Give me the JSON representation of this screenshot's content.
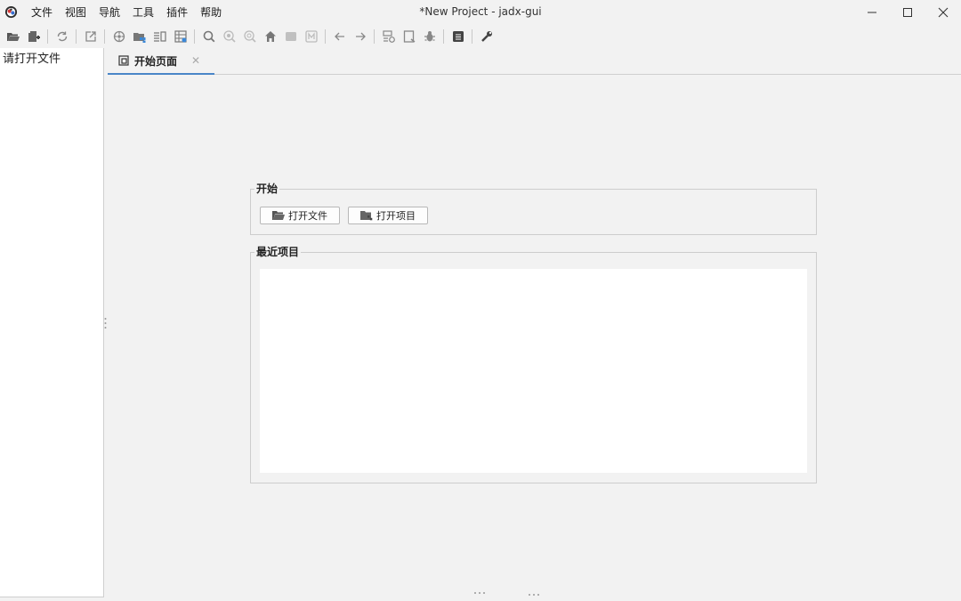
{
  "window": {
    "title": "*New Project - jadx-gui",
    "controls": [
      "minimize-icon",
      "maximize-icon",
      "close-icon"
    ]
  },
  "menu": {
    "items": [
      "文件",
      "视图",
      "导航",
      "工具",
      "插件",
      "帮助"
    ]
  },
  "toolbar": {
    "icons": [
      "open-file-icon",
      "add-files-icon",
      "reload-icon",
      "export-icon",
      "sync-icon",
      "deobfuscation-icon",
      "flatten-icon",
      "tree-icon",
      "search-icon",
      "find-class-icon",
      "find-usage-icon",
      "home-icon",
      "stop-icon",
      "mark-icon",
      "back-icon",
      "forward-icon",
      "decompile-all-icon",
      "bookmark-icon",
      "debug-icon",
      "log-icon",
      "preferences-icon"
    ]
  },
  "tree": {
    "hint": "请打开文件"
  },
  "tabs": [
    {
      "label": "开始页面",
      "icon": "start-page-icon",
      "active": true
    }
  ],
  "start": {
    "title": "开始",
    "open_file_label": "打开文件",
    "open_project_label": "打开项目"
  },
  "recent": {
    "title": "最近项目",
    "items": []
  },
  "colors": {
    "accent": "#4a86c8",
    "background": "#f2f2f2",
    "panel": "#ffffff"
  }
}
